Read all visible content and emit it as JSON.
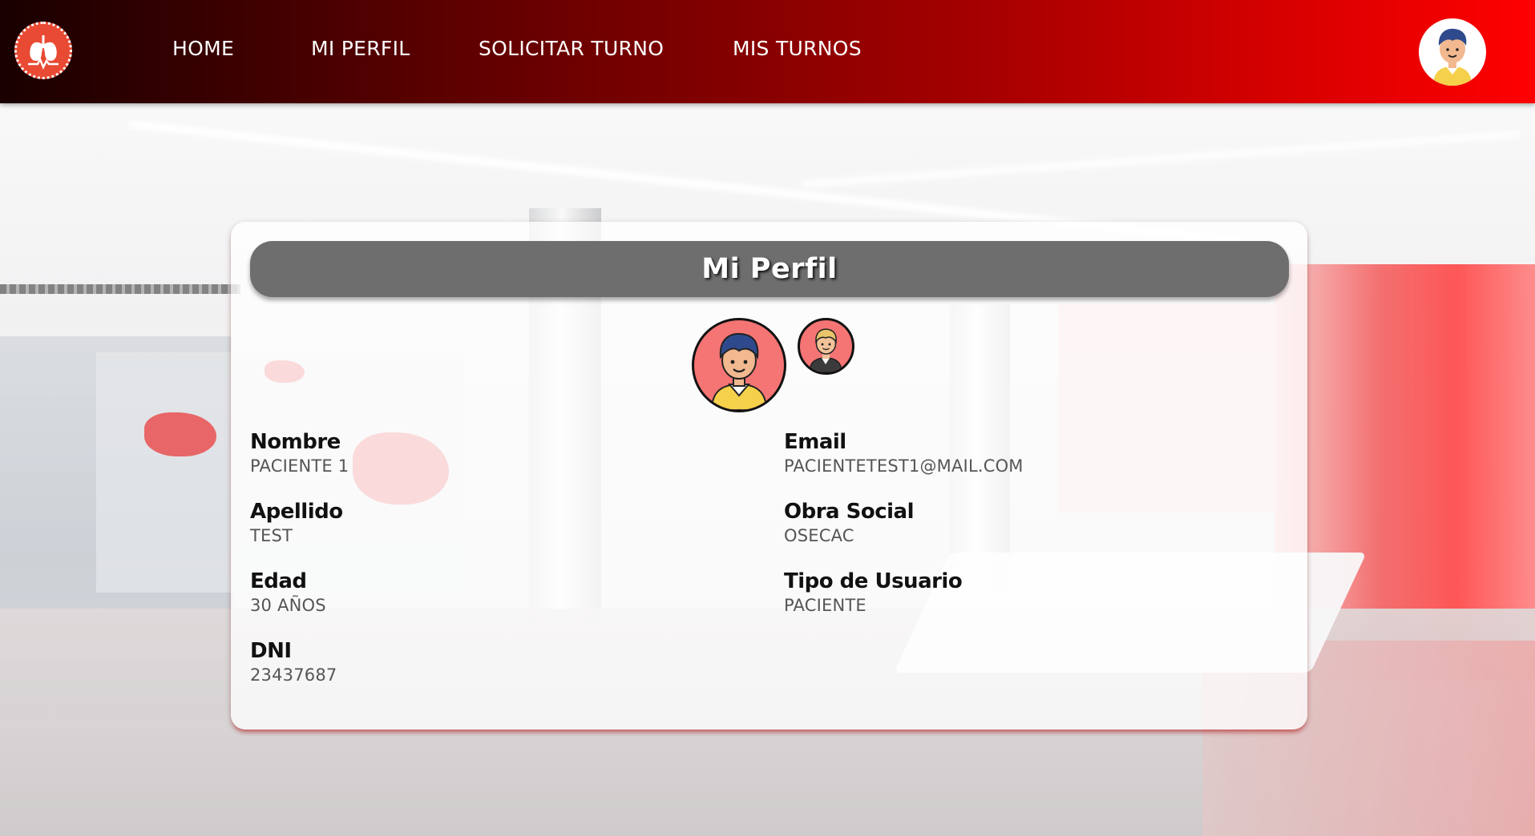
{
  "nav": {
    "links": [
      "HOME",
      "MI PERFIL",
      "SOLICITAR TURNO",
      "MIS TURNOS"
    ]
  },
  "profile": {
    "title": "Mi Perfil",
    "fields": [
      {
        "label": "Nombre",
        "value": "PACIENTE 1"
      },
      {
        "label": "Apellido",
        "value": "TEST"
      },
      {
        "label": "Edad",
        "value": "30 AÑOS"
      },
      {
        "label": "DNI",
        "value": "23437687"
      },
      {
        "label": "Email",
        "value": "PACIENTETEST1@MAIL.COM"
      },
      {
        "label": "Obra Social",
        "value": "OSECAC"
      },
      {
        "label": "Tipo de Usuario",
        "value": "PACIENTE"
      }
    ]
  },
  "icons": {
    "logo": "lungs-heartbeat-logo-icon",
    "user_avatar": "user-avatar-icon"
  },
  "colors": {
    "navbar_start": "#190000",
    "navbar_end": "#ff0000",
    "title_bar": "#6e6e6e",
    "avatar_bg": "#f57474"
  }
}
